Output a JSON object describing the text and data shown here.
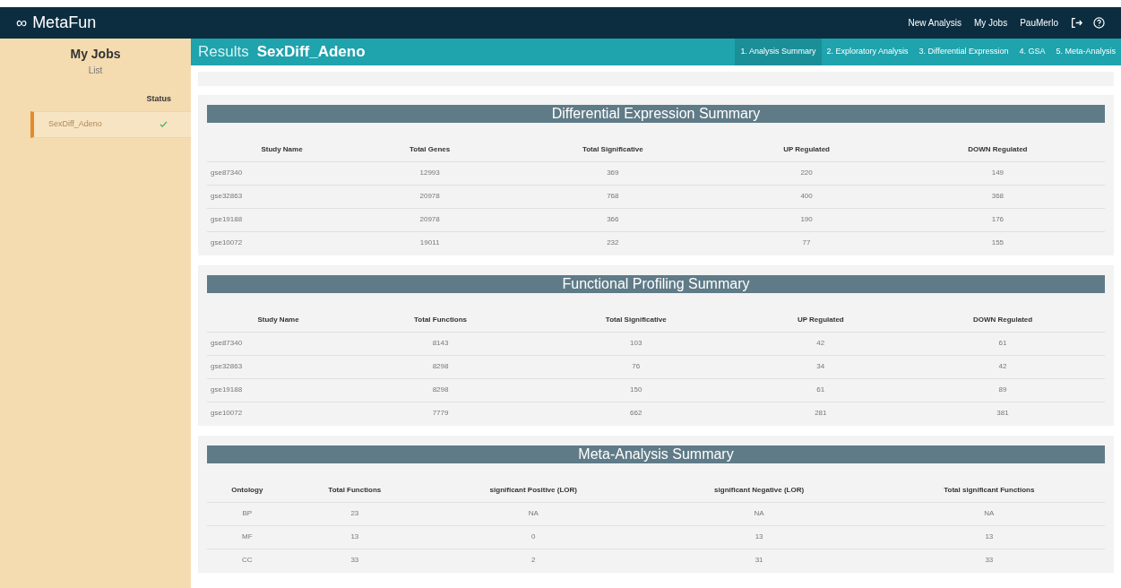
{
  "app": {
    "logo": "∞",
    "title": "MetaFun"
  },
  "nav": [
    "New Analysis",
    "My Jobs",
    "PauMerlo"
  ],
  "sidebar": {
    "title": "My Jobs",
    "subtitle": "List",
    "status_header": "Status",
    "jobs": [
      {
        "name": "SexDiff_Adeno",
        "done": true,
        "selected": true
      }
    ]
  },
  "results": {
    "label": "Results",
    "name": "SexDiff_Adeno"
  },
  "tabs": [
    {
      "label": "1. Analysis Summary",
      "selected": true
    },
    {
      "label": "2. Exploratory Analysis",
      "selected": false
    },
    {
      "label": "3. Differential Expression",
      "selected": false
    },
    {
      "label": "4. GSA",
      "selected": false
    },
    {
      "label": "5. Meta-Analysis",
      "selected": false
    }
  ],
  "tables": [
    {
      "title": "Differential Expression Summary",
      "kind": "study",
      "columns": [
        "Study Name",
        "Total Genes",
        "Total Significative",
        "UP Regulated",
        "DOWN Regulated"
      ],
      "rows": [
        [
          "gse87340",
          "12993",
          "369",
          "220",
          "149"
        ],
        [
          "gse32863",
          "20978",
          "768",
          "400",
          "368"
        ],
        [
          "gse19188",
          "20978",
          "366",
          "190",
          "176"
        ],
        [
          "gse10072",
          "19011",
          "232",
          "77",
          "155"
        ]
      ]
    },
    {
      "title": "Functional Profiling Summary",
      "kind": "study",
      "columns": [
        "Study Name",
        "Total Functions",
        "Total Significative",
        "UP Regulated",
        "DOWN Regulated"
      ],
      "rows": [
        [
          "gse87340",
          "8143",
          "103",
          "42",
          "61"
        ],
        [
          "gse32863",
          "8298",
          "76",
          "34",
          "42"
        ],
        [
          "gse19188",
          "8298",
          "150",
          "61",
          "89"
        ],
        [
          "gse10072",
          "7779",
          "662",
          "281",
          "381"
        ]
      ]
    },
    {
      "title": "Meta-Analysis Summary",
      "kind": "ontology",
      "columns": [
        "Ontology",
        "Total Functions",
        "significant Positive (LOR)",
        "significant Negative (LOR)",
        "Total significant Functions"
      ],
      "rows": [
        [
          "BP",
          "23",
          "NA",
          "NA",
          "NA"
        ],
        [
          "MF",
          "13",
          "0",
          "13",
          "13"
        ],
        [
          "CC",
          "33",
          "2",
          "31",
          "33"
        ]
      ]
    }
  ]
}
